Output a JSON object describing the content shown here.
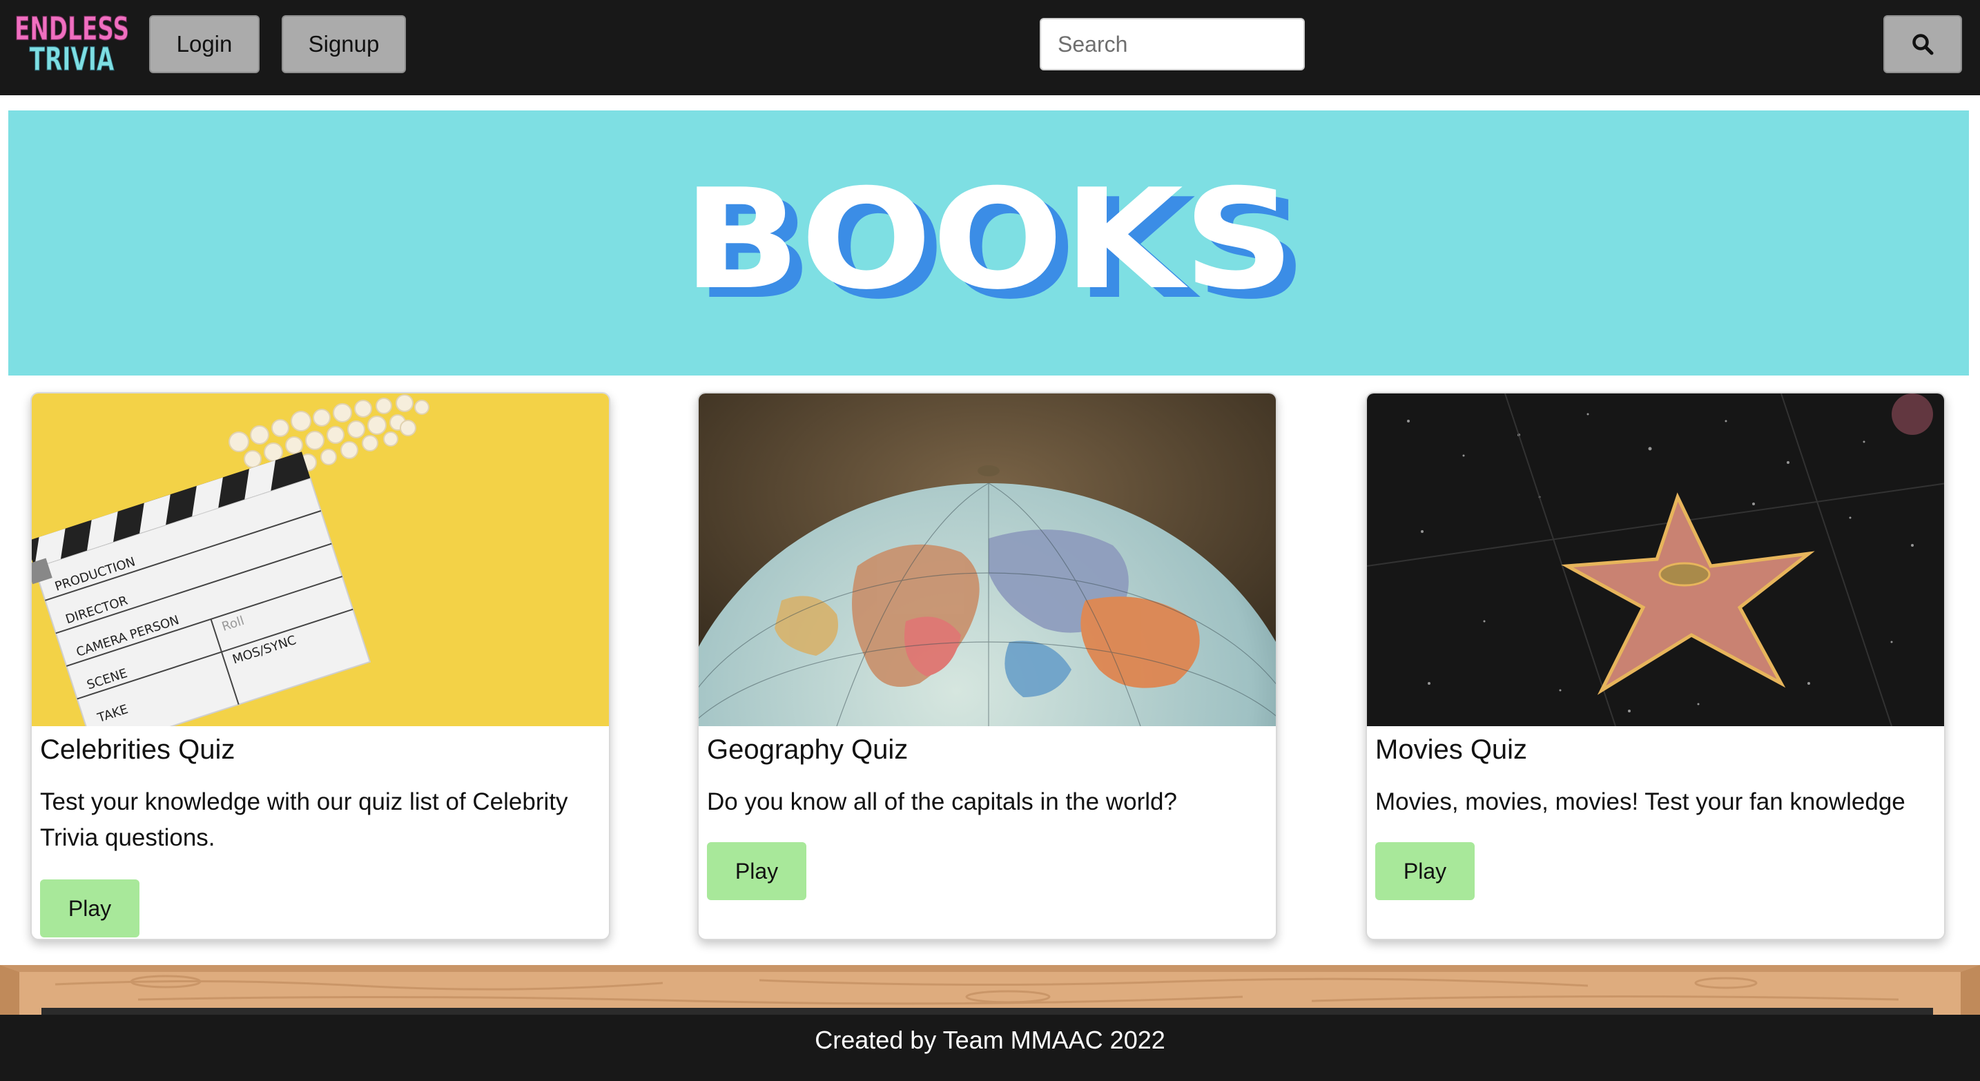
{
  "navbar": {
    "logo": {
      "line1": "ENDLESS",
      "line2": "TRIVIA",
      "colors": {
        "line1": "#f06fc0",
        "line2": "#7edfe3"
      }
    },
    "login_label": "Login",
    "signup_label": "Signup",
    "search": {
      "placeholder": "Search",
      "value": ""
    },
    "search_icon": "search-icon"
  },
  "hero": {
    "title": "BOOKS",
    "background": "#7edfe3",
    "title_color": "#ffffff",
    "shadow_color": "#3b8de6"
  },
  "cards": [
    {
      "title": "Celebrities Quiz",
      "description": "Test your knowledge with our quiz list of Celebrity Trivia questions.",
      "play_label": "Play",
      "image": "clapperboard-with-popcorn"
    },
    {
      "title": "Geography Quiz",
      "description": "Do you know all of the capitals in the world?",
      "play_label": "Play",
      "image": "globe-showing-africa"
    },
    {
      "title": "Movies Quiz",
      "description": "Movies, movies, movies! Test your fan knowledge",
      "play_label": "Play",
      "image": "hollywood-walk-of-fame-star"
    }
  ],
  "clapperboard_labels": [
    "PRODUCTION",
    "DIRECTOR",
    "CAMERA PERSON",
    "SCENE",
    "TAKE",
    "Roll",
    "MOS/SYNC"
  ],
  "footer": {
    "text": "Created by Team MMAAC 2022"
  },
  "colors": {
    "nav_bg": "#181818",
    "nav_button": "#ababab",
    "play_button": "#a8e89a",
    "footer_bg": "#181818",
    "shelf_wood": "#deac7e"
  }
}
